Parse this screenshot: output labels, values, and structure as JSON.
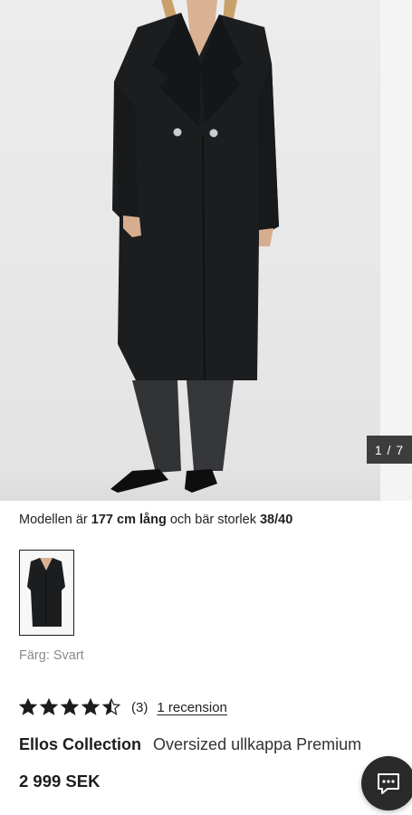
{
  "gallery": {
    "counter": "1 / 7",
    "current": 1,
    "total": 7
  },
  "model_info": {
    "prefix": "Modellen är",
    "height": "177 cm lång",
    "middle": "och bär storlek",
    "size": "38/40"
  },
  "color": {
    "label": "Färg: Svart"
  },
  "rating": {
    "stars": 4.5,
    "max": 5,
    "count": "(3)",
    "review_link": "1 recension"
  },
  "product": {
    "brand": "Ellos Collection",
    "name": "Oversized ullkappa Premium",
    "price": "2 999 SEK"
  },
  "icons": {
    "chat": "chat-icon",
    "star": "star-icon"
  },
  "colors": {
    "coat": "#1b1d1f",
    "counter_bg": "#3d3d3d",
    "chat_bg": "#2a2a2a"
  }
}
